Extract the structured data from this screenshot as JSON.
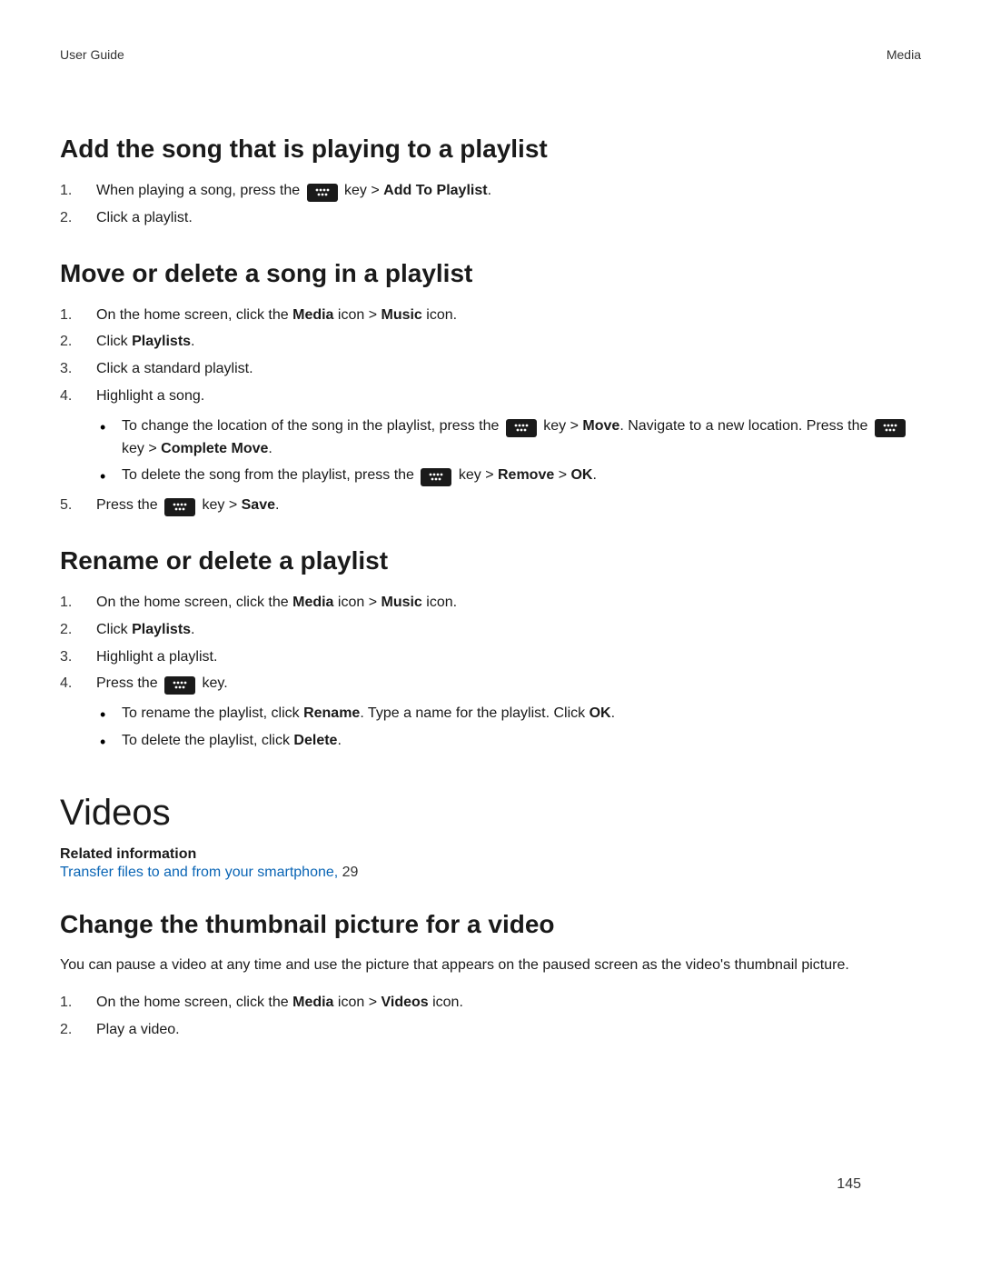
{
  "header": {
    "left": "User Guide",
    "right": "Media"
  },
  "pageNumber": "145",
  "sect1": {
    "title": "Add the song that is playing to a playlist",
    "li1a": "When playing a song, press the ",
    "li1b": " key > ",
    "li1c": "Add To Playlist",
    "li1d": ".",
    "li2": "Click a playlist."
  },
  "sect2": {
    "title": "Move or delete a song in a playlist",
    "li1a": "On the home screen, click the ",
    "li1b": "Media",
    "li1c": " icon > ",
    "li1d": "Music",
    "li1e": " icon.",
    "li2a": "Click ",
    "li2b": "Playlists",
    "li2c": ".",
    "li3": "Click a standard playlist.",
    "li4": "Highlight a song.",
    "b1a": "To change the location of the song in the playlist, press the ",
    "b1b": " key > ",
    "b1c": "Move",
    "b1d": ". Navigate to a new location. Press the ",
    "b1e": " key > ",
    "b1f": "Complete Move",
    "b1g": ".",
    "b2a": "To delete the song from the playlist, press the ",
    "b2b": " key > ",
    "b2c": "Remove",
    "b2d": " > ",
    "b2e": "OK",
    "b2f": ".",
    "li5a": "Press the ",
    "li5b": " key > ",
    "li5c": "Save",
    "li5d": "."
  },
  "sect3": {
    "title": "Rename or delete a playlist",
    "li1a": "On the home screen, click the ",
    "li1b": "Media",
    "li1c": " icon > ",
    "li1d": "Music",
    "li1e": " icon.",
    "li2a": "Click ",
    "li2b": "Playlists",
    "li2c": ".",
    "li3": "Highlight a playlist.",
    "li4a": "Press the ",
    "li4b": " key.",
    "b1a": "To rename the playlist, click ",
    "b1b": "Rename",
    "b1c": ". Type a name for the playlist. Click ",
    "b1d": "OK",
    "b1e": ".",
    "b2a": "To delete the playlist, click ",
    "b2b": "Delete",
    "b2c": "."
  },
  "videos": {
    "title": "Videos",
    "relHead": "Related information",
    "relLinkText": "Transfer files to and from your smartphone, ",
    "relLinkPage": "29"
  },
  "sect4": {
    "title": "Change the thumbnail picture for a video",
    "para": "You can pause a video at any time and use the picture that appears on the paused screen as the video's thumbnail picture.",
    "li1a": "On the home screen, click the ",
    "li1b": "Media",
    "li1c": " icon > ",
    "li1d": "Videos",
    "li1e": " icon.",
    "li2": "Play a video."
  }
}
